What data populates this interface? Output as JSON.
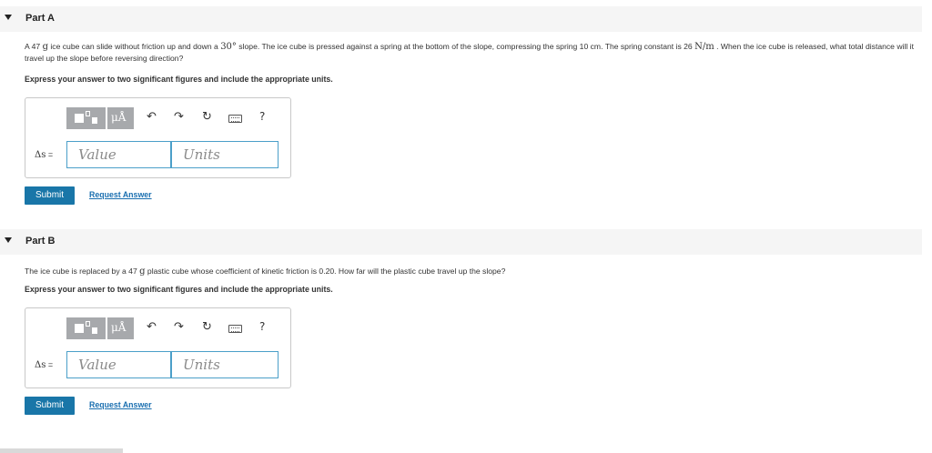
{
  "partA": {
    "title": "Part A",
    "question": {
      "p1": "A 47 ",
      "g": "g",
      "p2": " ice cube can slide without friction up and down a ",
      "angle": "30°",
      "p3": " slope. The ice cube is pressed against a spring at the bottom of the slope, compressing the spring 10 cm. The spring constant is 26 ",
      "k_unit": "N/m",
      "p4": " . When the ice cube is released, what total distance will it travel up the slope before reversing direction?"
    },
    "instruction": "Express your answer to two significant figures and include the appropriate units.",
    "label": "Δs",
    "eq": " =",
    "value_placeholder": "Value",
    "units_placeholder": "Units",
    "submit": "Submit",
    "request": "Request Answer"
  },
  "partB": {
    "title": "Part B",
    "question": {
      "p1": "The ice cube is replaced by a 47 ",
      "g": "g",
      "p2": " plastic cube whose coefficient of kinetic friction is 0.20. How far will the plastic cube travel up the slope?"
    },
    "instruction": "Express your answer to two significant figures and include the appropriate units.",
    "label": "Δs",
    "eq": " =",
    "value_placeholder": "Value",
    "units_placeholder": "Units",
    "submit": "Submit",
    "request": "Request Answer"
  },
  "toolbar": {
    "mu_label": "μÅ",
    "undo": "↶",
    "redo": "↷",
    "reset": "↻",
    "help": "?"
  },
  "icons": [
    "templates-icon",
    "units-symbol-icon",
    "undo-icon",
    "redo-icon",
    "reset-icon",
    "keyboard-icon",
    "help-icon",
    "collapse-arrow-icon"
  ]
}
